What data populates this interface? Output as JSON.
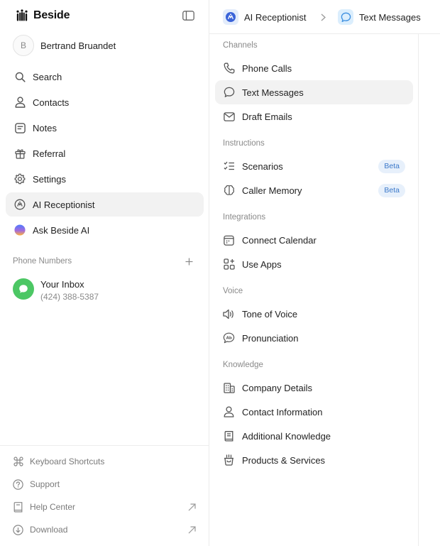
{
  "app": {
    "name": "Beside"
  },
  "user": {
    "initial": "B",
    "name": "Bertrand Bruandet"
  },
  "nav": {
    "search": "Search",
    "contacts": "Contacts",
    "notes": "Notes",
    "referral": "Referral",
    "settings": "Settings",
    "ai_receptionist": "AI Receptionist",
    "ask_ai": "Ask Beside AI"
  },
  "phone_numbers": {
    "heading": "Phone Numbers",
    "inbox_name": "Your Inbox",
    "inbox_number": "(424) 388-5387"
  },
  "footer": {
    "shortcuts": "Keyboard Shortcuts",
    "support": "Support",
    "help": "Help Center",
    "download": "Download"
  },
  "breadcrumb": {
    "parent": "AI Receptionist",
    "current": "Text Messages"
  },
  "menu": {
    "channels": {
      "heading": "Channels",
      "phone_calls": "Phone Calls",
      "text_messages": "Text Messages",
      "draft_emails": "Draft Emails"
    },
    "instructions": {
      "heading": "Instructions",
      "scenarios": "Scenarios",
      "scenarios_badge": "Beta",
      "caller_memory": "Caller Memory",
      "caller_memory_badge": "Beta"
    },
    "integrations": {
      "heading": "Integrations",
      "connect_calendar": "Connect Calendar",
      "use_apps": "Use Apps"
    },
    "voice": {
      "heading": "Voice",
      "tone": "Tone of Voice",
      "pronunciation": "Pronunciation"
    },
    "knowledge": {
      "heading": "Knowledge",
      "company": "Company Details",
      "contact": "Contact Information",
      "additional": "Additional Knowledge",
      "products": "Products & Services"
    }
  },
  "colors": {
    "active_bg": "#f2f2f2",
    "inbox_green": "#4cc764",
    "beta_bg": "#e7f0fb",
    "beta_text": "#3b78c9",
    "muted_text": "#8a8a8a"
  }
}
